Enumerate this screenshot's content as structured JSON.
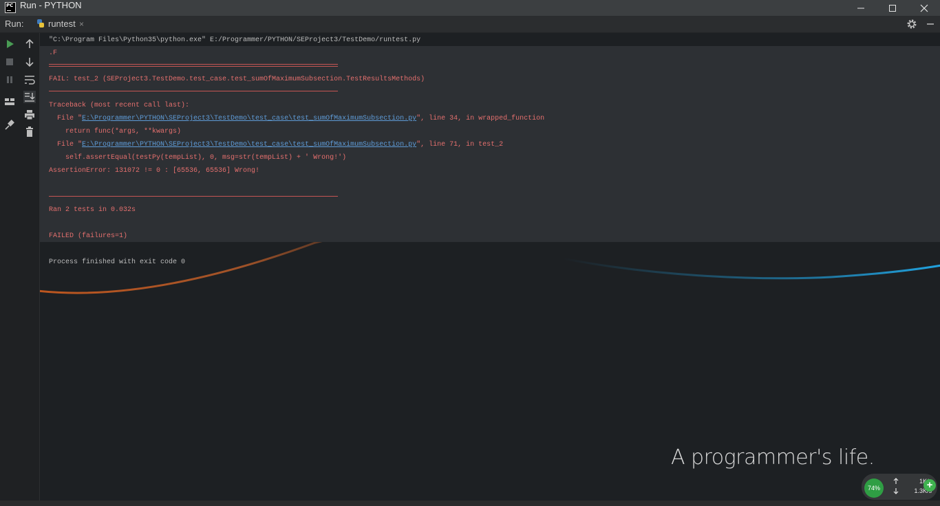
{
  "window": {
    "title": "Run - PYTHON",
    "app_logo": "PC"
  },
  "run_panel": {
    "label": "Run:",
    "tab": {
      "label": "runtest",
      "close": "×",
      "icon": "python-icon"
    }
  },
  "console": {
    "lines": [
      "\"C:\\Program Files\\Python35\\python.exe\" E:/Programmer/PYTHON/SEProject3/TestDemo/runtest.py",
      ".F",
      "FAIL: test_2 (SEProject3.TestDemo.test_case.test_sumOfMaximumSubsection.TestResultsMethods)",
      "Traceback (most recent call last):",
      "  File \"",
      "E:\\Programmer\\PYTHON\\SEProject3\\TestDemo\\test_case\\test_sumOfMaximumSubsection.py",
      "\", line 34, in wrapped_function",
      "    return func(*args, **kwargs)",
      "  File \"",
      "E:\\Programmer\\PYTHON\\SEProject3\\TestDemo\\test_case\\test_sumOfMaximumSubsection.py",
      "\", line 71, in test_2",
      "    self.assertEqual(testPy(tempList), 0, msg=str(tempList) + ' Wrong!')",
      "AssertionError: 131072 != 0 : [65536, 65536] Wrong!",
      "Ran 2 tests in 0.032s",
      "FAILED (failures=1)",
      "Process finished with exit code 0"
    ]
  },
  "wallpaper": {
    "tagline": "A programmer's life."
  },
  "net_monitor": {
    "cpu": "74%",
    "upload": "1K/s",
    "download": "1.3K/s",
    "boost": "+"
  },
  "colors": {
    "error": "#e5706e",
    "link": "#5f9cd8",
    "run_green": "#499c54",
    "accent_orange": "#e0601c",
    "accent_blue": "#1e90c8"
  }
}
